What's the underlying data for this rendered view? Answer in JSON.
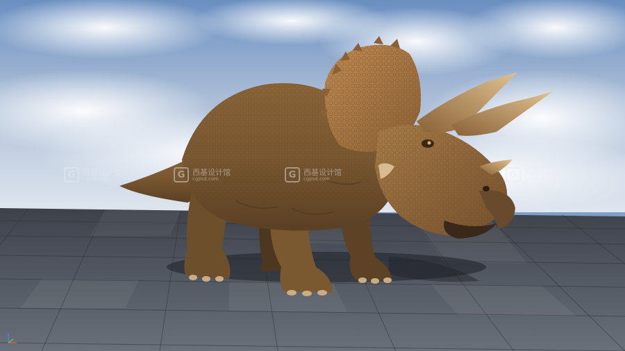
{
  "scene": {
    "subject": "triceratops",
    "sky_color": "#7f9fc6",
    "floor_color": "#4f5560",
    "skin_color": "#9a7040"
  },
  "watermarks": [
    {
      "icon": "g-logo-icon",
      "brand": "西基设计馆",
      "sub": "cgpsd.com"
    },
    {
      "icon": "g-logo-icon",
      "brand": "西基设计馆",
      "sub": "cgpsd.com"
    },
    {
      "icon": "g-logo-icon",
      "brand": "西基设计馆",
      "sub": "cgpsd.com"
    },
    {
      "icon": "g-logo-icon",
      "brand": "西基设计馆",
      "sub": "cgpsd.com"
    }
  ],
  "viewport": {
    "axis_gizmo_icon": "axis-gizmo-icon"
  }
}
